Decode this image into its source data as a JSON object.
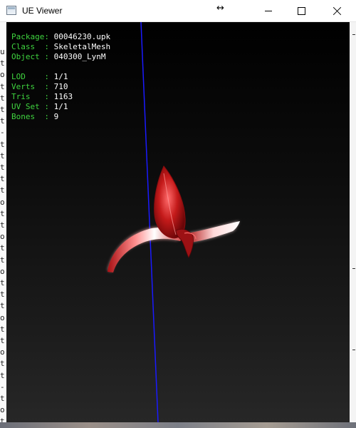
{
  "window": {
    "title": "UE Viewer"
  },
  "info": {
    "package": {
      "label": "Package",
      "value": "00046230.upk"
    },
    "class": {
      "label": "Class  ",
      "value": "SkeletalMesh"
    },
    "object": {
      "label": "Object ",
      "value": "040300_LynM"
    },
    "lod": {
      "label": "LOD    ",
      "value": "1/1"
    },
    "verts": {
      "label": "Verts  ",
      "value": "710"
    },
    "tris": {
      "label": "Tris   ",
      "value": "1163"
    },
    "uvset": {
      "label": "UV Set ",
      "value": "1/1"
    },
    "bones": {
      "label": "Bones  ",
      "value": "9"
    }
  },
  "background": {
    "console_chars": [
      "u",
      "t",
      "o",
      "t",
      "t",
      "t",
      "t",
      "-",
      "t",
      "t",
      "t",
      "t",
      "t",
      "o",
      "t",
      "t",
      "o",
      "t",
      "t",
      "o",
      "t",
      "t",
      "t",
      "o",
      "t",
      "t",
      "o",
      "t",
      "t",
      "-",
      "t",
      "o",
      "t"
    ]
  },
  "colors": {
    "key_text": "#3fd43f",
    "value_text": "#ffffff",
    "axis_line": "#1a1aff",
    "mesh": "#c41a1a"
  }
}
